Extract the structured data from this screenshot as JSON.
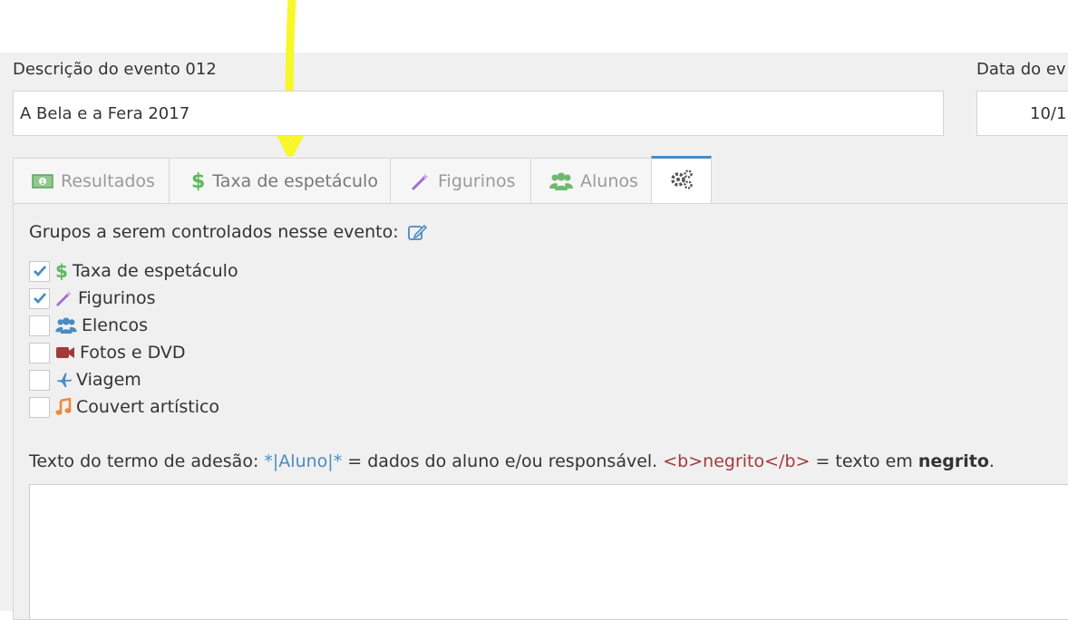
{
  "form": {
    "description_label": "Descrição do evento 012",
    "description_value": "A Bela e a Fera 2017",
    "date_label": "Data do ev",
    "date_value": "10/1"
  },
  "tabs": [
    {
      "label": "Resultados",
      "icon": "money-icon"
    },
    {
      "label": "Taxa de espetáculo",
      "icon": "dollar-icon"
    },
    {
      "label": "Figurinos",
      "icon": "magic-wand-icon"
    },
    {
      "label": "Alunos",
      "icon": "users-icon"
    },
    {
      "label": "",
      "icon": "gears-icon",
      "active": true
    }
  ],
  "groups": {
    "title": "Grupos a serem controlados nesse evento:",
    "items": [
      {
        "label": "Taxa de espetáculo",
        "checked": true,
        "icon": "dollar-icon"
      },
      {
        "label": "Figurinos",
        "checked": true,
        "icon": "magic-wand-icon"
      },
      {
        "label": "Elencos",
        "checked": false,
        "icon": "users-icon"
      },
      {
        "label": "Fotos e DVD",
        "checked": false,
        "icon": "video-camera-icon"
      },
      {
        "label": "Viagem",
        "checked": false,
        "icon": "plane-icon"
      },
      {
        "label": "Couvert artístico",
        "checked": false,
        "icon": "music-note-icon"
      }
    ]
  },
  "terms": {
    "label": "Texto do termo de adesão:",
    "placeholder_token": "*|Aluno|*",
    "token_desc": " = dados do aluno e/ou responsável. ",
    "bold_example": "<b>negrito</b>",
    "bold_desc": " = texto em ",
    "bold_word": "negrito",
    "end": "."
  },
  "colors": {
    "accent": "#4a8bc2",
    "highlight": "#f7f72a",
    "green": "#5cb85c",
    "purple": "#9b6fce",
    "red": "#a33a3a",
    "orange": "#f0883a"
  }
}
